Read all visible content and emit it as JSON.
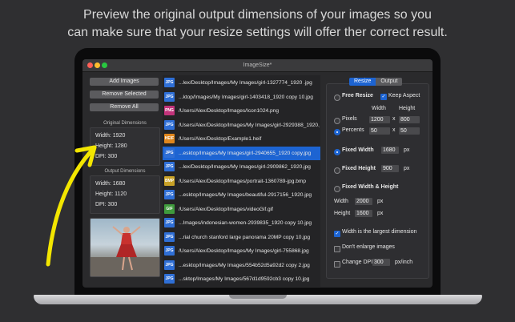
{
  "headline": {
    "line1": "Preview the original output dimensions of your images so you",
    "line2": "can make sure that your resize settings will offer ther correct result."
  },
  "window": {
    "title": "ImageSize*"
  },
  "buttons": {
    "add": "Add Images",
    "remove_selected": "Remove Selected",
    "remove_all": "Remove All"
  },
  "original": {
    "label": "Original Dimensions",
    "width": "Width: 1920",
    "height": "Height: 1280",
    "dpi": "DPI: 300"
  },
  "output": {
    "label": "Output Dimensions",
    "width": "Width: 1680",
    "height": "Height: 1120",
    "dpi": "DPI: 300"
  },
  "files": [
    {
      "type": "JPG",
      "path": "...lex/Desktop/Images/My Images/girl-1327774_1920 .jpg",
      "color": "#2f6fd6"
    },
    {
      "type": "JPG",
      "path": "...ktop/Images/My Images/girl-1403418_1920 copy 10.jpg",
      "color": "#2f6fd6"
    },
    {
      "type": "PNG",
      "path": "/Users/Alex/Desktop/Images/Icon1024.png",
      "color": "#c2337a"
    },
    {
      "type": "JPG",
      "path": "/Users/Alex/Desktop/Images/My Images/girl-2929388_1920.jpg",
      "color": "#2f6fd6"
    },
    {
      "type": "HEIF",
      "path": "/Users/Alex/Desktop/Example1.heif",
      "color": "#e0861c"
    },
    {
      "type": "JPG",
      "path": "...esktop/Images/My Images/girl-2940655_1920 copy.jpg",
      "color": "#2f6fd6"
    },
    {
      "type": "JPG",
      "path": "...lex/Desktop/Images/My Images/girl-2909862_1920.jpg",
      "color": "#2f6fd6"
    },
    {
      "type": "BMP",
      "path": "/Users/Alex/Desktop/Images/portrait-1360789-jpg.bmp",
      "color": "#c9a227"
    },
    {
      "type": "JPG",
      "path": "...esktop/Images/My Images/beautiful-2917156_1920.jpg",
      "color": "#2f6fd6"
    },
    {
      "type": "GIF",
      "path": "/Users/Alex/Desktop/Images/videoGif.gif",
      "color": "#3f9a3c"
    },
    {
      "type": "JPG",
      "path": "...Images/indonesian-women-2939835_1920 copy 10.jpg",
      "color": "#2f6fd6"
    },
    {
      "type": "JPG",
      "path": "...rial church stanford large panorama 20MP copy 10.jpg",
      "color": "#2f6fd6"
    },
    {
      "type": "JPG",
      "path": "/Users/Alex/Desktop/Images/My Images/girl-755868.jpg",
      "color": "#2f6fd6"
    },
    {
      "type": "JPG",
      "path": "...esktop/Images/My Images/554b52d5a92d2 copy 2.jpg",
      "color": "#2f6fd6"
    },
    {
      "type": "JPG",
      "path": "...sktop/Images/My Images/567d1d9592cb3 copy 10.jpg",
      "color": "#2f6fd6"
    }
  ],
  "selected_index": 5,
  "tabs": {
    "resize": "Resize",
    "output": "Output"
  },
  "settings": {
    "free_resize": "Free Resize",
    "keep_aspect": "Keep Aspect",
    "col_width": "Width",
    "col_height": "Height",
    "pixels": "Pixels",
    "pixels_w": "1200",
    "pixels_h": "800",
    "percents": "Percents",
    "percents_w": "50",
    "percents_h": "50",
    "x": "x",
    "fixed_width": "Fixed Width",
    "fixed_width_val": "1680",
    "fixed_height": "Fixed Height",
    "fixed_height_val": "900",
    "px": "px",
    "fixed_wh": "Fixed Width & Height",
    "width_label": "Width",
    "width_val": "2000",
    "height_label": "Height",
    "height_val": "1600",
    "largest_dim": "Width is the largest dimension",
    "dont_enlarge": "Don't enlarge images",
    "change_dpi": "Change DPI",
    "dpi_val": "300",
    "px_inch": "px/inch"
  },
  "colors": {
    "accent": "#1d64d2",
    "arrow": "#f3e600"
  }
}
